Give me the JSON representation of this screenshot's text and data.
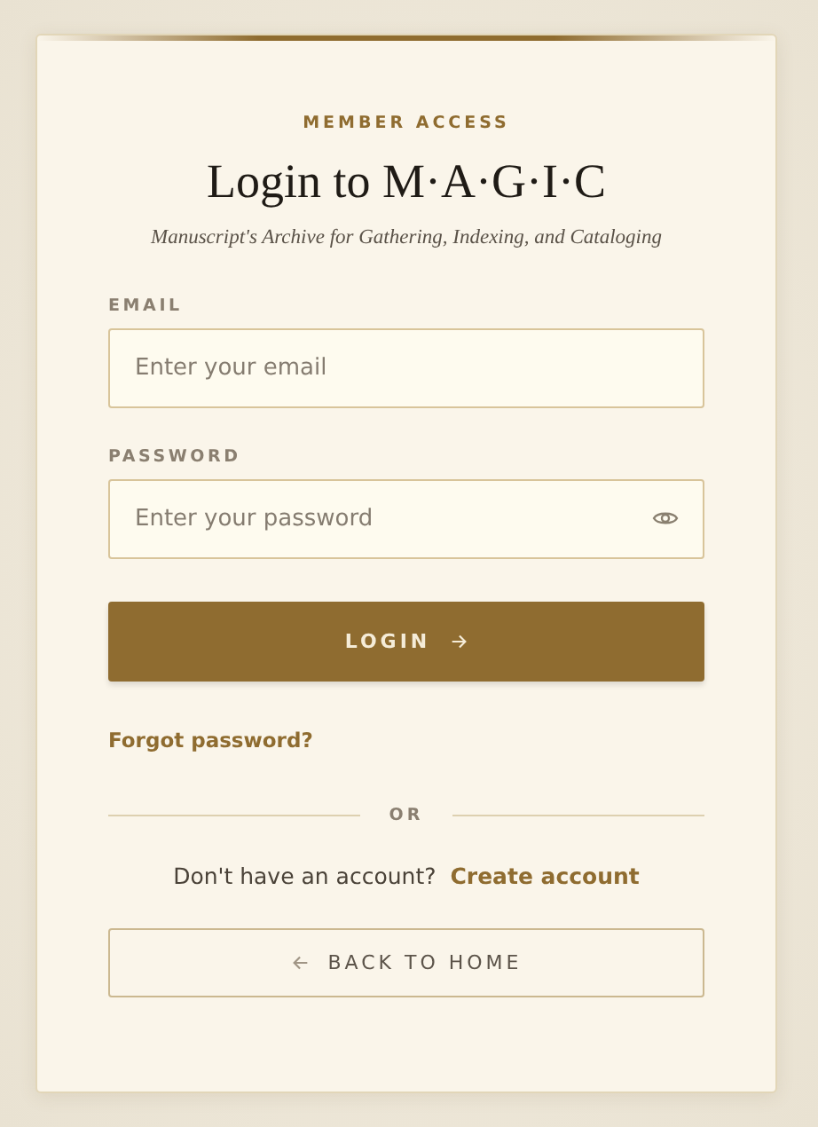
{
  "eyebrow": "MEMBER ACCESS",
  "title": "Login to M·A·G·I·C",
  "subtitle": "Manuscript's Archive for Gathering, Indexing, and Cataloging",
  "fields": [
    {
      "label": "EMAIL",
      "placeholder": "Enter your email",
      "kind": "text"
    },
    {
      "label": "PASSWORD",
      "placeholder": "Enter your password",
      "kind": "password"
    }
  ],
  "login_button": "LOGIN",
  "forgot_link": "Forgot password?",
  "divider": "OR",
  "signup_prompt": "Don't have an account?",
  "signup_link": "Create account",
  "back_button": "BACK TO HOME"
}
